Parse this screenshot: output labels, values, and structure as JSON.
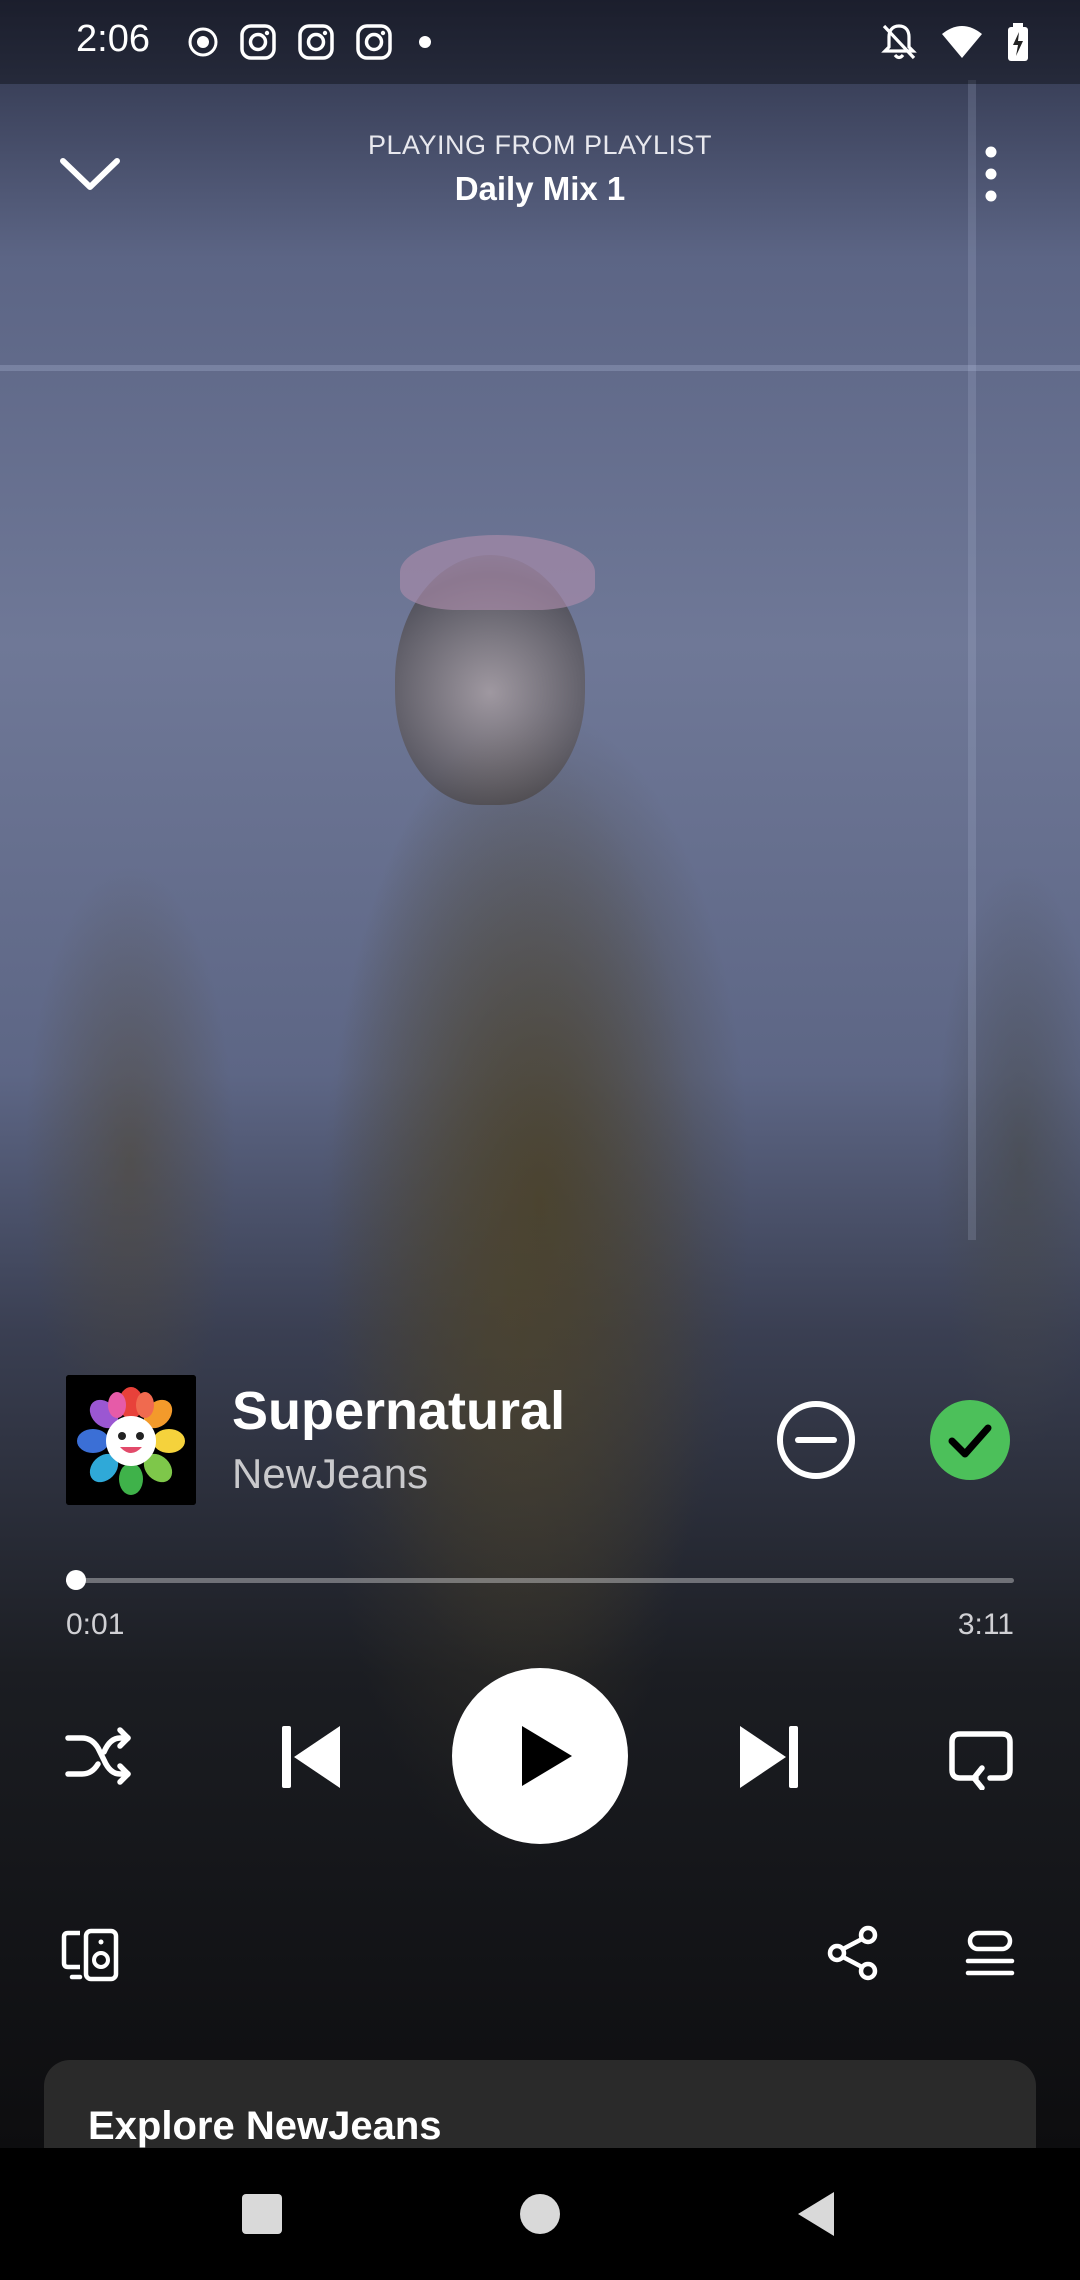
{
  "status_bar": {
    "time": "2:06",
    "left_icons": [
      "record-icon",
      "instagram-icon",
      "instagram-icon",
      "instagram-icon",
      "dot-icon"
    ],
    "right_icons": [
      "bell-off-icon",
      "wifi-icon",
      "battery-charging-icon"
    ]
  },
  "header": {
    "context_label": "PLAYING FROM PLAYLIST",
    "playlist_name": "Daily Mix 1"
  },
  "track": {
    "title": "Supernatural",
    "artist": "NewJeans",
    "saved": true
  },
  "progress": {
    "elapsed": "0:01",
    "total": "3:11",
    "fraction": 0.005
  },
  "explore": {
    "title": "Explore NewJeans"
  },
  "colors": {
    "accent": "#1ed760",
    "saved_check": "#4cc05a",
    "card": "#2a2a2a"
  }
}
